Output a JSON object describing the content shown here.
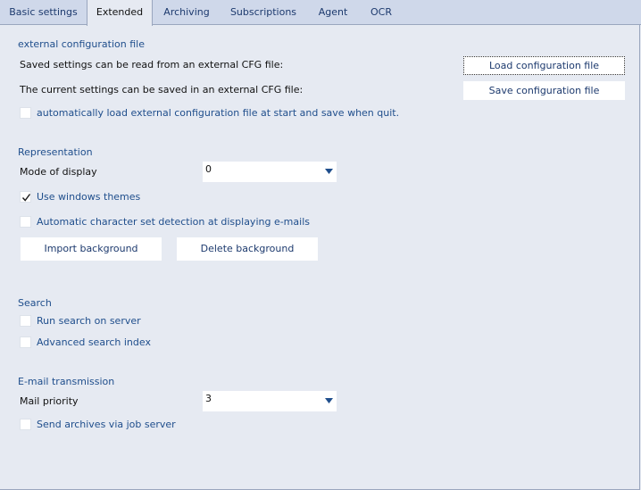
{
  "tabs": [
    {
      "label": "Basic settings"
    },
    {
      "label": "Extended"
    },
    {
      "label": "Archiving"
    },
    {
      "label": "Subscriptions"
    },
    {
      "label": "Agent"
    },
    {
      "label": "OCR"
    }
  ],
  "external_config": {
    "title": "external configuration file",
    "read_text": "Saved settings can be read from an external CFG file:",
    "save_text": "The current settings can be saved in an external CFG file:",
    "load_button": "Load configuration file",
    "save_button": "Save configuration file",
    "autoload_label": "automatically load external configuration file at start and save when quit.",
    "autoload_checked": false
  },
  "representation": {
    "title": "Representation",
    "mode_label": "Mode of display",
    "mode_value": "0",
    "themes_label": "Use windows themes",
    "themes_checked": true,
    "charset_label": "Automatic character set detection at displaying e-mails",
    "charset_checked": false,
    "import_button": "Import background",
    "delete_button": "Delete background"
  },
  "search": {
    "title": "Search",
    "server_label": "Run search on server",
    "server_checked": false,
    "index_label": "Advanced search index",
    "index_checked": false
  },
  "email": {
    "title": "E-mail transmission",
    "priority_label": "Mail priority",
    "priority_value": "3",
    "jobserver_label": "Send archives via job server",
    "jobserver_checked": false
  },
  "colors": {
    "accent": "#1f4e8c",
    "background": "#e6eaf2",
    "tabbar": "#cfd8ea"
  }
}
